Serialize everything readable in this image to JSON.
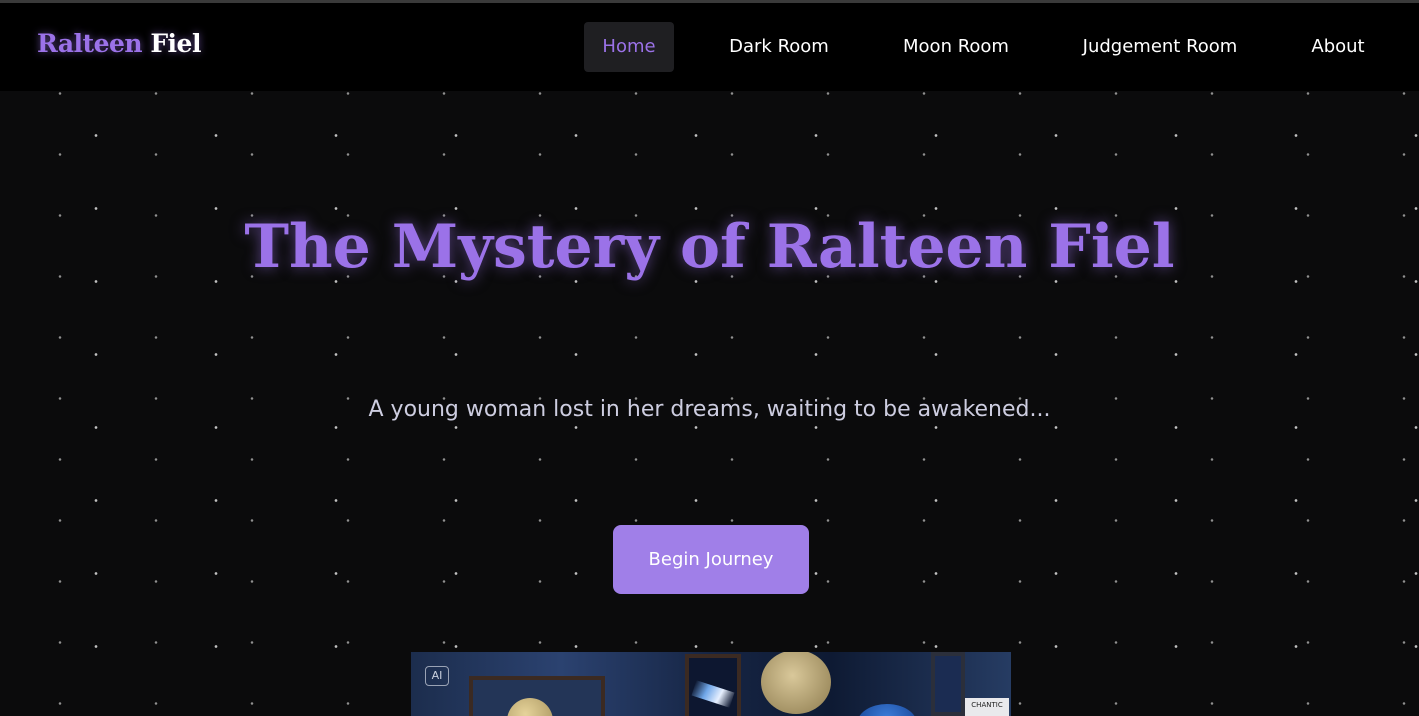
{
  "brand": {
    "part1": "Ralteen",
    "part2": "Fiel"
  },
  "nav": {
    "items": [
      {
        "label": "Home",
        "active": true
      },
      {
        "label": "Dark Room",
        "active": false
      },
      {
        "label": "Moon Room",
        "active": false
      },
      {
        "label": "Judgement Room",
        "active": false
      },
      {
        "label": "About",
        "active": false
      }
    ]
  },
  "hero": {
    "title": "The Mystery of Ralteen Fiel",
    "subtitle": "A young woman lost in her dreams, waiting to be awakened...",
    "cta_label": "Begin Journey"
  },
  "preview": {
    "ai_badge": "AI",
    "wall_label": "CHANTIC"
  },
  "colors": {
    "accent": "#9b72e8",
    "button": "#a07fe8",
    "background": "#0b0b0c",
    "navbar": "#000000",
    "active_tab_bg": "#1f1f22"
  }
}
